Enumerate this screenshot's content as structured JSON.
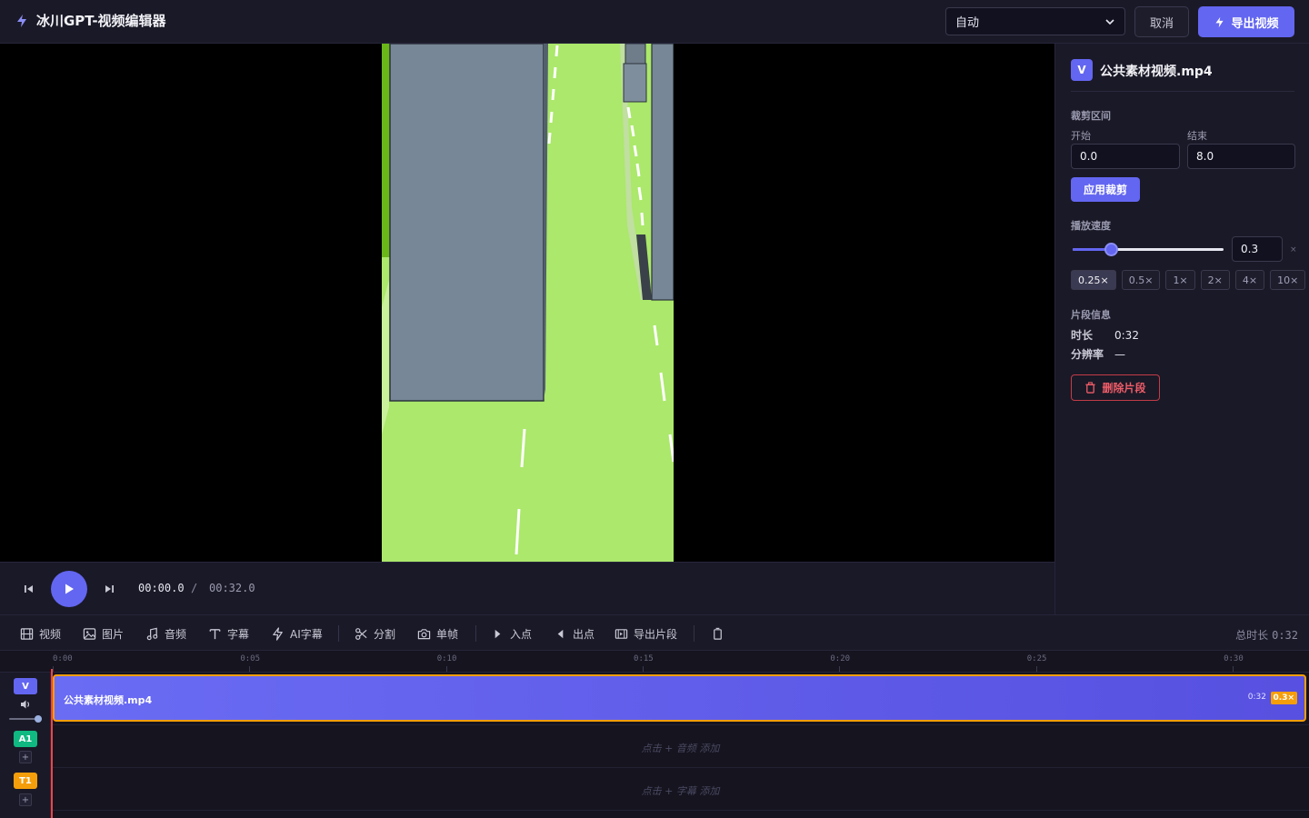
{
  "header": {
    "title": "冰川GPT-视频编辑器",
    "quality_value": "自动",
    "cancel_label": "取消",
    "export_label": "导出视频"
  },
  "playback": {
    "current_time": "00:00.0",
    "separator": "/",
    "total_time": "00:32.0"
  },
  "panel": {
    "clip_badge": "V",
    "clip_name": "公共素材视频.mp4",
    "trim_title": "裁剪区间",
    "start_label": "开始",
    "start_value": "0.0",
    "end_label": "结束",
    "end_value": "8.0",
    "apply_label": "应用裁剪",
    "speed_title": "播放速度",
    "speed_value": "0.3",
    "speed_unit": "×",
    "speed_fraction": 0.23,
    "presets": [
      "0.25×",
      "0.5×",
      "1×",
      "2×",
      "4×",
      "10×"
    ],
    "active_preset": "0.25×",
    "info_title": "片段信息",
    "duration_label": "时长",
    "duration_value": "0:32",
    "resolution_label": "分辨率",
    "resolution_value": "—",
    "delete_label": "删除片段"
  },
  "toolbar": {
    "video": "视频",
    "image": "图片",
    "audio": "音频",
    "subtitle": "字幕",
    "ai_subtitle": "AI字幕",
    "split": "分割",
    "single_frame": "单帧",
    "in_point": "入点",
    "out_point": "出点",
    "export_segment": "导出片段",
    "total_label": "总时长",
    "total_value": "0:32"
  },
  "timeline": {
    "ticks": [
      "0:00",
      "0:05",
      "0:10",
      "0:15",
      "0:20",
      "0:25",
      "0:30"
    ],
    "video_track_badge": "V",
    "audio_track_badge": "A1",
    "text_track_badge": "T1",
    "add_symbol": "+",
    "clip_label": "公共素材视频.mp4",
    "clip_duration": "0:32",
    "clip_speed": "0.3×",
    "audio_hint": "点击 + 音频 添加",
    "subtitle_hint": "点击 + 字幕 添加"
  },
  "colors": {
    "accent": "#6366f1",
    "clip_border": "#f59e0b",
    "danger": "#ef5c68",
    "audio_badge": "#10b981",
    "text_badge": "#f59e0b",
    "playhead": "#ef4444"
  }
}
